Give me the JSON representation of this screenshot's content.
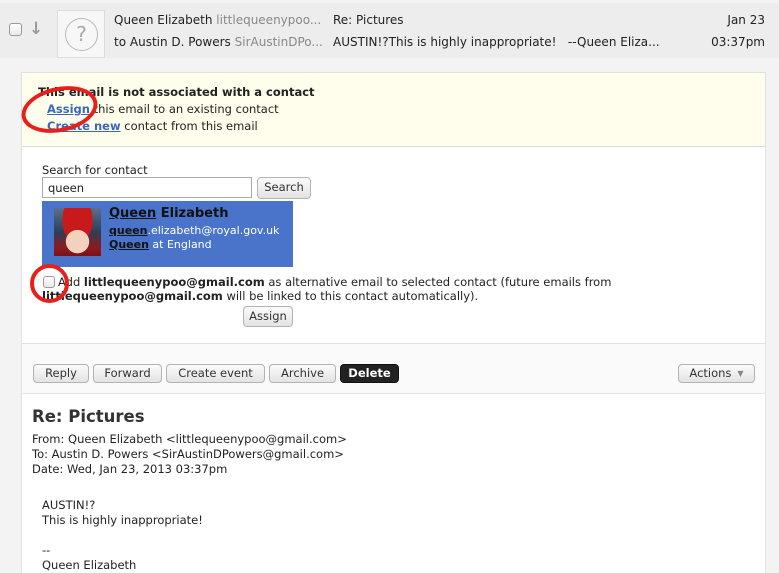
{
  "message_row": {
    "sender_name": "Queen Elizabeth",
    "sender_email_truncated": "littlequeenypoo...",
    "to_prefix": "to",
    "recipient_name": "Austin D. Powers",
    "recipient_email_truncated": "SirAustinDPo...",
    "subject": "Re: Pictures",
    "preview": "AUSTIN!?This is highly inappropriate!   --Queen Eliza...",
    "date": "Jan 23",
    "time": "03:37pm",
    "avatar_placeholder": "?",
    "arrow_glyph": "↓"
  },
  "notice": {
    "title": "This email is not associated with a contact",
    "assign_link": "Assign",
    "assign_rest": " this email to an existing contact",
    "create_link": "Create new",
    "create_rest": " contact from this email"
  },
  "search": {
    "label": "Search for contact",
    "value": "queen",
    "button": "Search"
  },
  "result": {
    "name_highlight": "Queen",
    "name_rest": " Elizabeth",
    "email_highlight": "queen",
    "email_rest": ".elizabeth@royal.gov.uk",
    "org_highlight": "Queen",
    "org_rest": " at England"
  },
  "alt_email": {
    "prefix": "Add ",
    "email": "littlequeenypoo@gmail.com",
    "middle": " as alternative email to selected contact (future emails from",
    "email2": "littlequeenypoo@gmail.com",
    "suffix": " will be linked to this contact automatically).",
    "assign_button": "Assign"
  },
  "toolbar": {
    "reply": "Reply",
    "forward": "Forward",
    "create_event": "Create event",
    "archive": "Archive",
    "delete": "Delete",
    "actions": "Actions",
    "actions_caret": "▼"
  },
  "email": {
    "subject": "Re: Pictures",
    "from": "From: Queen Elizabeth <littlequeenypoo@gmail.com>",
    "to": "To: Austin D. Powers <SirAustinDPowers@gmail.com>",
    "date": "Date: Wed, Jan 23, 2013 03:37pm",
    "body_lines": [
      "AUSTIN!?",
      "This is highly inappropriate!",
      "--",
      "Queen Elizabeth"
    ]
  },
  "colors": {
    "notice_bg": "#fffdeb",
    "link": "#3b67b8",
    "result_bg": "#4a74c9",
    "annotation": "#e8201b"
  }
}
